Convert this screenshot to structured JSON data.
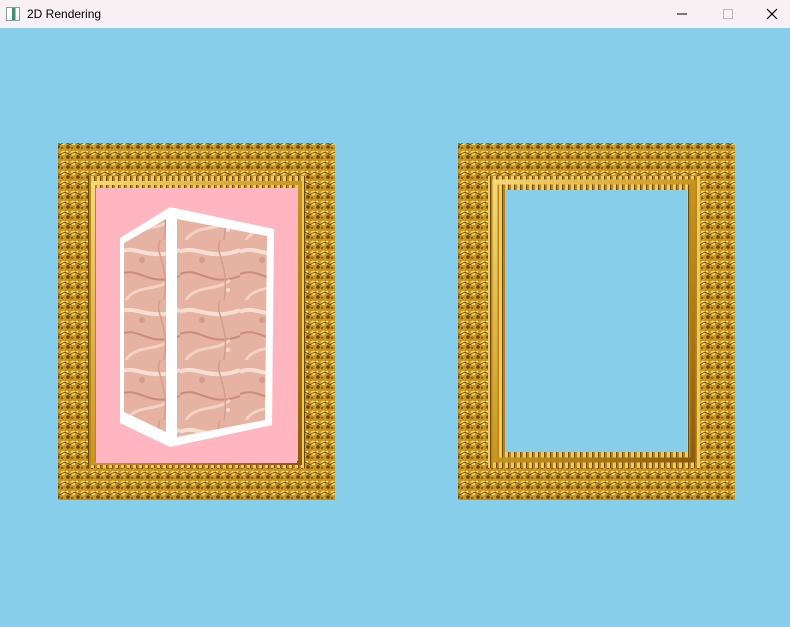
{
  "window": {
    "title": "2D Rendering",
    "background_color": "#87CEEA",
    "controls": {
      "minimize_icon": "minimize-icon",
      "maximize_icon": "maximize-icon",
      "close_icon": "close-icon"
    }
  },
  "scene": {
    "frames": [
      {
        "content": "marble-cube-on-pink",
        "mat_color": "#FFB6C1"
      },
      {
        "content": "empty",
        "mat_color": "#87CEEA"
      }
    ],
    "frame_color": "#C8961E"
  }
}
